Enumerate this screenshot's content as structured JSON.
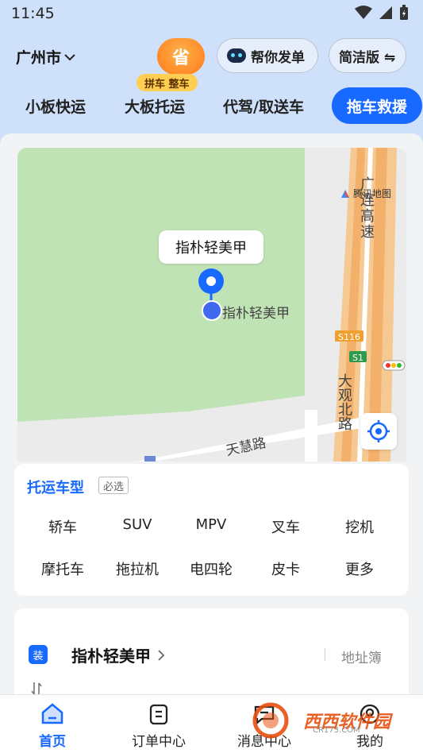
{
  "status": {
    "time": "11:45"
  },
  "header": {
    "city": "广州市",
    "save_badge": "省",
    "help_label": "帮你发单",
    "simple_label": "简洁版 ⇋",
    "pin_tag": "拼车 整车"
  },
  "tabs": [
    "小板快运",
    "大板托运",
    "代驾/取送车",
    "拖车救援"
  ],
  "map": {
    "tooltip": "指朴轻美甲",
    "marker_label": "指朴轻美甲",
    "provider": "腾讯地图",
    "road_expressway": "广连高速",
    "road_tianhui": "天慧路",
    "road_daguan": "大观北路",
    "shield_s116": "S116",
    "shield_s1": "S1"
  },
  "vehicle_type": {
    "title": "托运车型",
    "required": "必选",
    "options": [
      "轿车",
      "SUV",
      "MPV",
      "叉车",
      "挖机",
      "摩托车",
      "拖拉机",
      "电四轮",
      "皮卡",
      "更多"
    ]
  },
  "address": {
    "badge": "装",
    "name": "指朴轻美甲",
    "book": "地址簿"
  },
  "nav": [
    "首页",
    "订单中心",
    "消息中心",
    "我的"
  ],
  "watermark": {
    "text": "西西软件园",
    "sub": "CR173.COM"
  },
  "colors": {
    "primary": "#1769ff",
    "map_park": "#bfe3b4",
    "expressway": "#f3b06a"
  }
}
